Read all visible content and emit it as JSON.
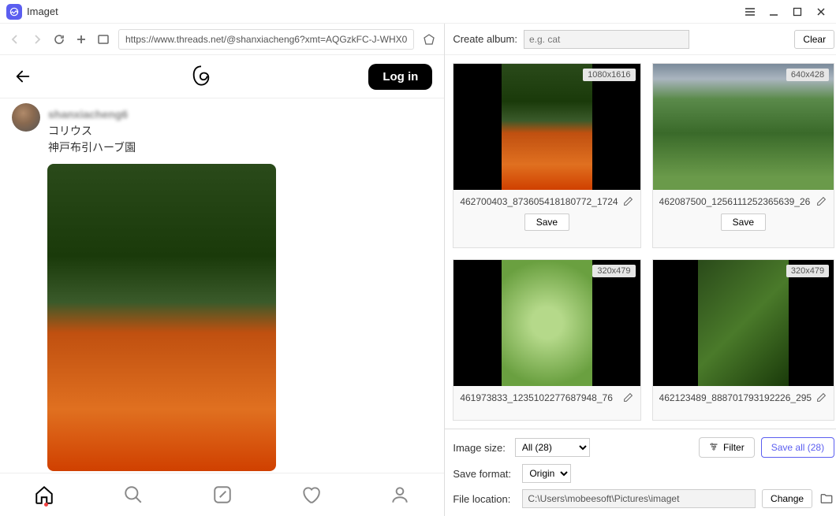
{
  "app": {
    "name": "Imaget"
  },
  "nav": {
    "url": "https://www.threads.net/@shanxiacheng6?xmt=AQGzkFC-J-WHX0"
  },
  "threads": {
    "login": "Log in",
    "post": {
      "username": "shanxiacheng6",
      "line1": "コリウス",
      "line2": "神戸布引ハーブ園"
    }
  },
  "right": {
    "album_label": "Create album:",
    "album_placeholder": "e.g. cat",
    "clear": "Clear",
    "images": [
      {
        "dim": "1080x1616",
        "name": "462700403_873605418180772_1724",
        "save": "Save",
        "cls": "img1",
        "wide": false
      },
      {
        "dim": "640x428",
        "name": "462087500_1256111252365639_26",
        "save": "Save",
        "cls": "img2",
        "wide": true
      },
      {
        "dim": "320x479",
        "name": "461973833_1235102277687948_76",
        "save": "",
        "cls": "img3",
        "wide": false
      },
      {
        "dim": "320x479",
        "name": "462123489_888701793192226_295",
        "save": "",
        "cls": "img4",
        "wide": false
      }
    ],
    "footer": {
      "size_label": "Image size:",
      "size_value": "All (28)",
      "filter": "Filter",
      "save_all": "Save all (28)",
      "format_label": "Save format:",
      "format_value": "Original",
      "location_label": "File location:",
      "location_value": "C:\\Users\\mobeesoft\\Pictures\\imaget",
      "change": "Change"
    }
  }
}
